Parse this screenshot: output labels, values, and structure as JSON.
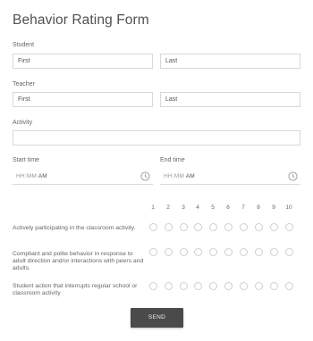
{
  "form": {
    "title": "Behavior Rating Form",
    "student": {
      "label": "Student",
      "first_placeholder": "First",
      "last_placeholder": "Last"
    },
    "teacher": {
      "label": "Teacher",
      "first_placeholder": "First",
      "last_placeholder": "Last"
    },
    "activity": {
      "label": "Activity",
      "value": ""
    },
    "start_time": {
      "label": "Start time",
      "placeholder": "HH:MM",
      "ampm": "AM",
      "icon": "clock-icon"
    },
    "end_time": {
      "label": "End time",
      "placeholder": "HH:MM",
      "ampm": "AM",
      "icon": "clock-icon"
    },
    "scale": [
      "1",
      "2",
      "3",
      "4",
      "5",
      "6",
      "7",
      "8",
      "9",
      "10"
    ],
    "questions": [
      "Actively participating in the classroom activity.",
      "Compliant and polite behavior in response to adult direction and/or interactions with peers and adults.",
      "Student action that interrupts regular school or classroom activity"
    ],
    "send_label": "SEND"
  }
}
